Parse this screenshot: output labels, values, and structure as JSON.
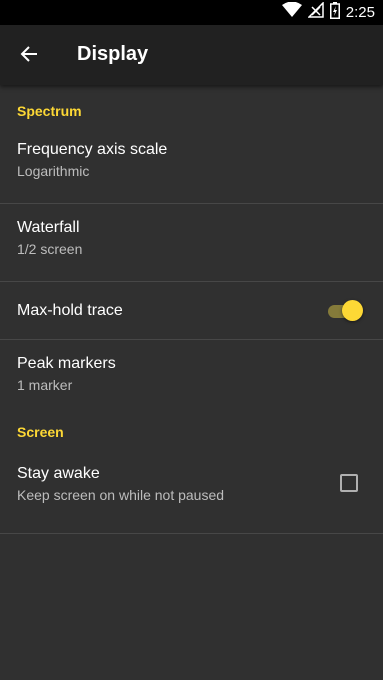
{
  "status_bar": {
    "time": "2:25",
    "icons": [
      "wifi-icon",
      "signal-icon",
      "battery-icon"
    ]
  },
  "app_bar": {
    "back_icon": "arrow-back-icon",
    "title": "Display"
  },
  "sections": [
    {
      "header": "Spectrum",
      "items": [
        {
          "title": "Frequency axis scale",
          "summary": "Logarithmic"
        },
        {
          "title": "Waterfall",
          "summary": "1/2 screen"
        },
        {
          "title": "Max-hold trace",
          "toggle_on": true
        },
        {
          "title": "Peak markers",
          "summary": "1 marker"
        }
      ]
    },
    {
      "header": "Screen",
      "items": [
        {
          "title": "Stay awake",
          "summary": "Keep screen on while not paused",
          "checked": false
        }
      ]
    }
  ],
  "colors": {
    "accent": "#fdd835",
    "background": "#303030",
    "app_bar": "#212121"
  }
}
